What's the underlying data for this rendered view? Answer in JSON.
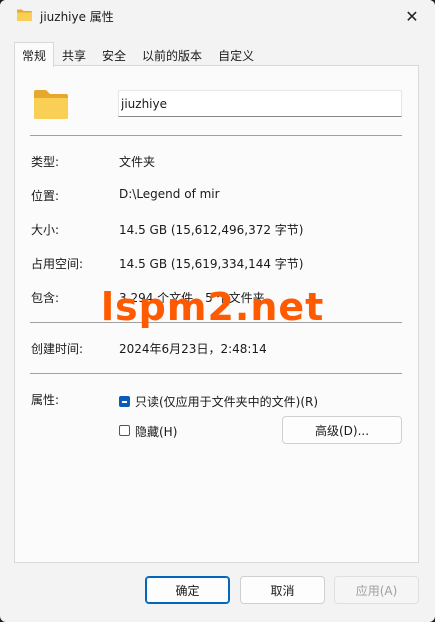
{
  "window": {
    "title": "jiuzhiye 属性",
    "close_glyph": "✕"
  },
  "tabs": [
    {
      "label": "常规",
      "active": true
    },
    {
      "label": "共享",
      "active": false
    },
    {
      "label": "安全",
      "active": false
    },
    {
      "label": "以前的版本",
      "active": false
    },
    {
      "label": "自定义",
      "active": false
    }
  ],
  "general": {
    "folder_name": "jiuzhiye",
    "rows": {
      "type": {
        "label": "类型:",
        "value": "文件夹"
      },
      "location": {
        "label": "位置:",
        "value": "D:\\Legend of mir"
      },
      "size": {
        "label": "大小:",
        "value": "14.5 GB (15,612,496,372 字节)"
      },
      "size_on_disk": {
        "label": "占用空间:",
        "value": "14.5 GB (15,619,334,144 字节)"
      },
      "contains": {
        "label": "包含:",
        "value": "3,294 个文件，5 个文件夹"
      },
      "created": {
        "label": "创建时间:",
        "value": "2024年6月23日，2:48:14"
      }
    },
    "attributes": {
      "label": "属性:",
      "readonly_label": "只读(仅应用于文件夹中的文件)(R)",
      "readonly_state": "indeterminate",
      "hidden_label": "隐藏(H)",
      "hidden_state": "unchecked",
      "advanced_label": "高级(D)..."
    }
  },
  "footer": {
    "ok_label": "确定",
    "cancel_label": "取消",
    "apply_label": "应用(A)"
  },
  "watermark": {
    "text": "lspm2.net",
    "color": "#ff5a00"
  },
  "colors": {
    "accent": "#0067c0",
    "folder": "#f7c64a"
  }
}
